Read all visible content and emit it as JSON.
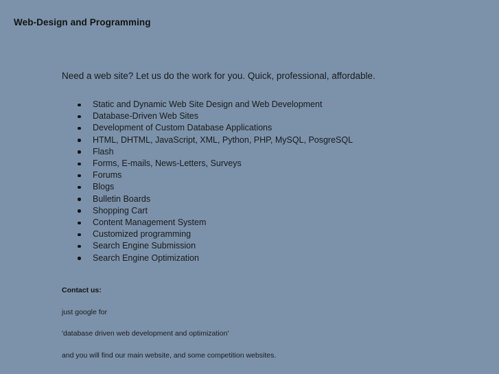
{
  "page": {
    "title": "Web-Design and Programming",
    "background_color": "#7b92aa",
    "text_color": "#1a1a1a"
  },
  "intro": {
    "tagline": "Need a web site? Let us do the work for you. Quick, professional, affordable."
  },
  "services": {
    "items": [
      "Static and Dynamic Web Site Design and Web Development",
      "Database-Driven Web Sites",
      "Development of Custom Database Applications",
      "HTML, DHTML, JavaScript, XML, Python, PHP, MySQL, PosgreSQL",
      "Flash",
      "Forms, E-mails, News-Letters, Surveys",
      "Forums",
      "Blogs",
      "Bulletin Boards",
      "Shopping Cart",
      "Content Management System",
      "Customized programming",
      "Search Engine Submission",
      "Search Engine Optimization"
    ]
  },
  "contact": {
    "heading": "Contact us:",
    "lines": [
      "just google for",
      "'database driven web development and optimization'",
      "and you will find our main website, and some competition websites."
    ]
  }
}
